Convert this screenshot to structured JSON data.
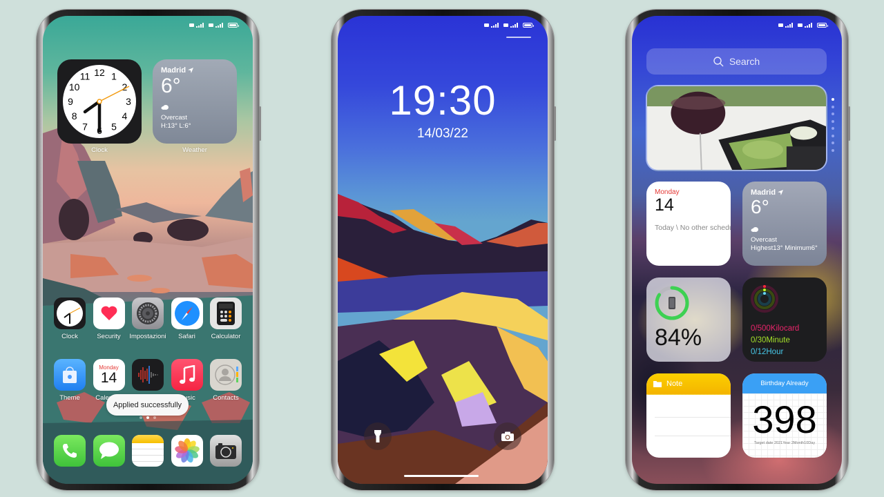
{
  "status_bar": {
    "battery_level": 0.85
  },
  "home_screen": {
    "clock_widget": {
      "label": "Clock",
      "hours_shown": [
        "12",
        "1",
        "2",
        "3",
        "4",
        "5",
        "6",
        "7",
        "8",
        "9",
        "10",
        "11"
      ],
      "time": "19:30"
    },
    "weather_widget": {
      "label": "Weather",
      "city": "Madrid",
      "temperature": "6°",
      "condition": "Overcast",
      "high_low": "H:13° L:6°"
    },
    "apps_row1": [
      {
        "name": "Clock",
        "icon": "clock-icon"
      },
      {
        "name": "Security",
        "icon": "heart-icon"
      },
      {
        "name": "Impostazioni",
        "icon": "settings-gear-icon"
      },
      {
        "name": "Safari",
        "icon": "compass-icon"
      },
      {
        "name": "Calculator",
        "icon": "calculator-icon"
      }
    ],
    "apps_row2": [
      {
        "name": "Theme",
        "icon": "shopping-bag-icon"
      },
      {
        "name": "Calendar",
        "icon": "calendar-icon",
        "day": "Monday",
        "date": "14"
      },
      {
        "name": "Voice Memos",
        "icon": "waveform-icon"
      },
      {
        "name": "Music",
        "icon": "music-note-icon"
      },
      {
        "name": "Contacts",
        "icon": "contact-person-icon"
      }
    ],
    "toast": "Applied successfully",
    "page_indicator": {
      "count": 3,
      "active": 1
    },
    "dock": [
      {
        "name": "Phone",
        "icon": "phone-icon"
      },
      {
        "name": "Messages",
        "icon": "message-bubble-icon"
      },
      {
        "name": "Notes",
        "icon": "notes-icon"
      },
      {
        "name": "Photos",
        "icon": "photos-flower-icon"
      },
      {
        "name": "Camera",
        "icon": "camera-icon"
      }
    ]
  },
  "lock_screen": {
    "time": "19:30",
    "date": "14/03/22",
    "left_shortcut": "flashlight-icon",
    "right_shortcut": "camera-icon"
  },
  "widget_screen": {
    "search_placeholder": "Search",
    "page_indicator": {
      "count": 8,
      "active": 0
    },
    "calendar_widget": {
      "day": "Monday",
      "date": "14",
      "schedule": "Today \\ No other schedule"
    },
    "weather_widget": {
      "city": "Madrid",
      "temperature": "6°",
      "condition": "Overcast",
      "high_low": "Highest13° Minimum6°"
    },
    "battery_widget": {
      "percent_label": "84%",
      "level": 0.84
    },
    "activity_widget": {
      "move": "0/500Kilocard",
      "exercise": "0/30Minute",
      "stand": "0/12Hour",
      "colors": {
        "move": "#e8246a",
        "exercise": "#a4e02a",
        "stand": "#47c8e8"
      }
    },
    "note_widget": {
      "title": "Note"
    },
    "birthday_widget": {
      "title": "Birthday Already",
      "days": "398",
      "target": "Target date 2021Year 2Month10Day"
    }
  }
}
